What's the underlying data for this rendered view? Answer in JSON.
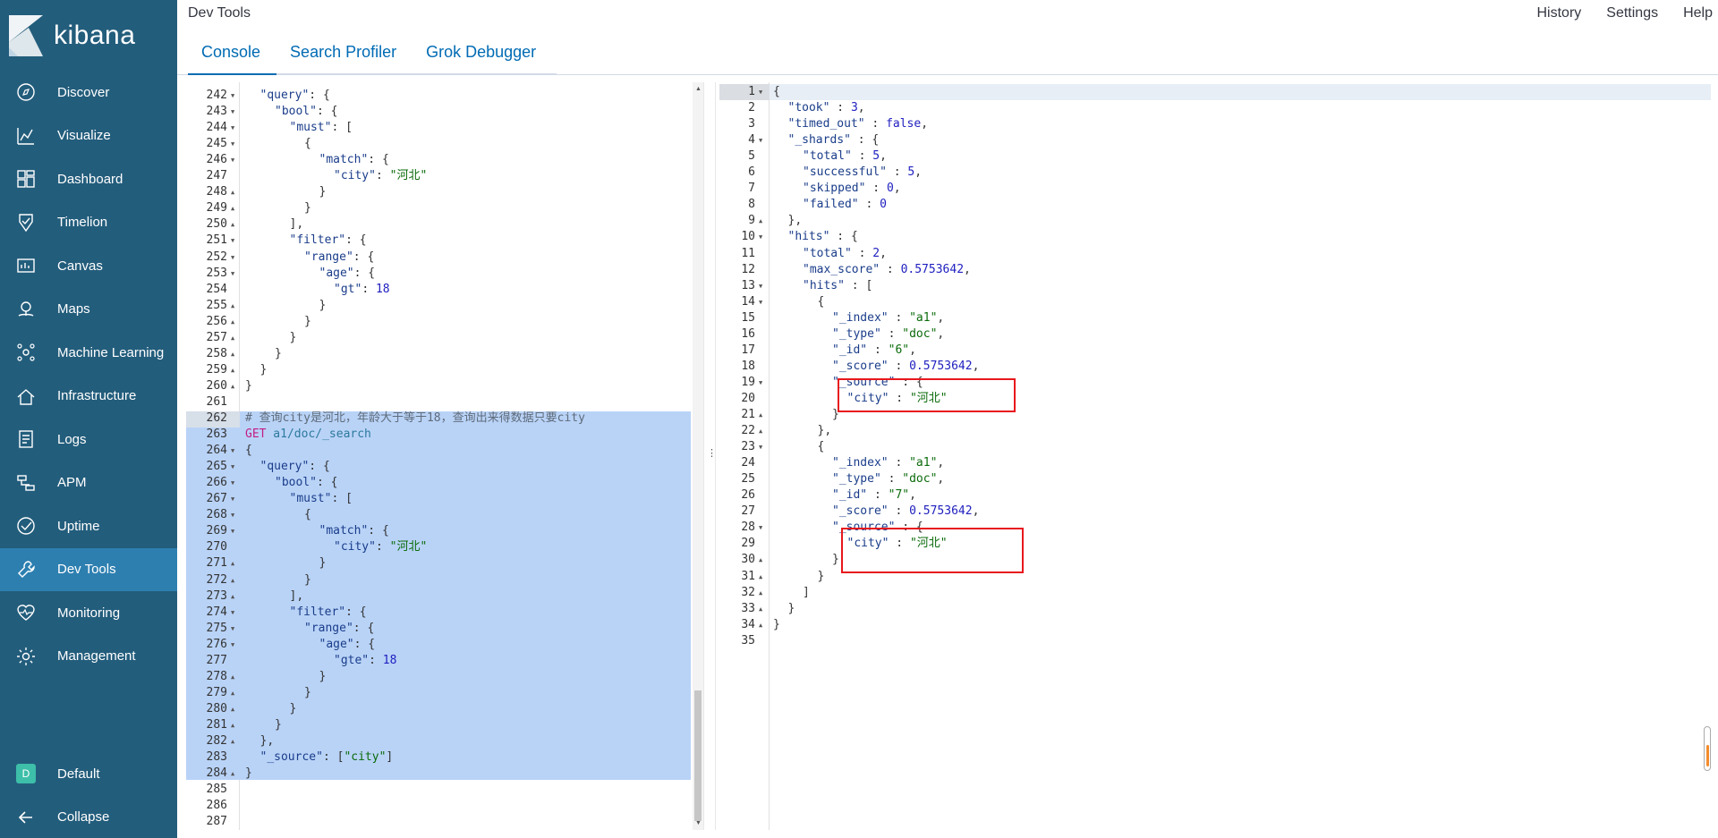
{
  "brand": {
    "name": "kibana"
  },
  "header": {
    "app_title": "Dev Tools",
    "links": [
      "History",
      "Settings",
      "Help"
    ],
    "tabs": [
      {
        "label": "Console",
        "active": true
      },
      {
        "label": "Search Profiler",
        "active": false
      },
      {
        "label": "Grok Debugger",
        "active": false
      }
    ]
  },
  "sidebar": {
    "items": [
      {
        "label": "Discover",
        "icon": "compass-icon"
      },
      {
        "label": "Visualize",
        "icon": "chart-icon"
      },
      {
        "label": "Dashboard",
        "icon": "dashboard-icon"
      },
      {
        "label": "Timelion",
        "icon": "timelion-icon"
      },
      {
        "label": "Canvas",
        "icon": "canvas-icon"
      },
      {
        "label": "Maps",
        "icon": "map-pin-icon"
      },
      {
        "label": "Machine Learning",
        "icon": "machine-learning-icon"
      },
      {
        "label": "Infrastructure",
        "icon": "infrastructure-icon"
      },
      {
        "label": "Logs",
        "icon": "logs-icon"
      },
      {
        "label": "APM",
        "icon": "apm-icon"
      },
      {
        "label": "Uptime",
        "icon": "uptime-icon"
      },
      {
        "label": "Dev Tools",
        "icon": "wrench-icon",
        "active": true
      },
      {
        "label": "Monitoring",
        "icon": "heartbeat-icon"
      },
      {
        "label": "Management",
        "icon": "gear-icon"
      }
    ],
    "space": {
      "badge": "D",
      "label": "Default"
    },
    "collapse_label": "Collapse"
  },
  "editor": {
    "lines": [
      {
        "n": "242",
        "f": "▼",
        "i": 1,
        "t": [
          [
            "key",
            "\"query\""
          ],
          [
            "k",
            ": {"
          ]
        ]
      },
      {
        "n": "243",
        "f": "▼",
        "i": 2,
        "t": [
          [
            "key",
            "\"bool\""
          ],
          [
            "k",
            ": {"
          ]
        ]
      },
      {
        "n": "244",
        "f": "▼",
        "i": 3,
        "t": [
          [
            "key",
            "\"must\""
          ],
          [
            "k",
            ": ["
          ]
        ]
      },
      {
        "n": "245",
        "f": "▼",
        "i": 4,
        "t": [
          [
            "k",
            "{"
          ]
        ]
      },
      {
        "n": "246",
        "f": "▼",
        "i": 5,
        "t": [
          [
            "key",
            "\"match\""
          ],
          [
            "k",
            ": {"
          ]
        ]
      },
      {
        "n": "247",
        "f": "",
        "i": 6,
        "t": [
          [
            "key",
            "\"city\""
          ],
          [
            "k",
            ": "
          ],
          [
            "str",
            "\"河北\""
          ]
        ]
      },
      {
        "n": "248",
        "f": "▲",
        "i": 5,
        "t": [
          [
            "k",
            "}"
          ]
        ]
      },
      {
        "n": "249",
        "f": "▲",
        "i": 4,
        "t": [
          [
            "k",
            "}"
          ]
        ]
      },
      {
        "n": "250",
        "f": "▲",
        "i": 3,
        "t": [
          [
            "k",
            "],"
          ]
        ]
      },
      {
        "n": "251",
        "f": "▼",
        "i": 3,
        "t": [
          [
            "key",
            "\"filter\""
          ],
          [
            "k",
            ": {"
          ]
        ]
      },
      {
        "n": "252",
        "f": "▼",
        "i": 4,
        "t": [
          [
            "key",
            "\"range\""
          ],
          [
            "k",
            ": {"
          ]
        ]
      },
      {
        "n": "253",
        "f": "▼",
        "i": 5,
        "t": [
          [
            "key",
            "\"age\""
          ],
          [
            "k",
            ": {"
          ]
        ]
      },
      {
        "n": "254",
        "f": "",
        "i": 6,
        "t": [
          [
            "key",
            "\"gt\""
          ],
          [
            "k",
            ": "
          ],
          [
            "num",
            "18"
          ]
        ]
      },
      {
        "n": "255",
        "f": "▲",
        "i": 5,
        "t": [
          [
            "k",
            "}"
          ]
        ]
      },
      {
        "n": "256",
        "f": "▲",
        "i": 4,
        "t": [
          [
            "k",
            "}"
          ]
        ]
      },
      {
        "n": "257",
        "f": "▲",
        "i": 3,
        "t": [
          [
            "k",
            "}"
          ]
        ]
      },
      {
        "n": "258",
        "f": "▲",
        "i": 2,
        "t": [
          [
            "k",
            "}"
          ]
        ]
      },
      {
        "n": "259",
        "f": "▲",
        "i": 1,
        "t": [
          [
            "k",
            "}"
          ]
        ]
      },
      {
        "n": "260",
        "f": "▲",
        "i": 0,
        "t": [
          [
            "k",
            "}"
          ]
        ]
      },
      {
        "n": "261",
        "f": "",
        "i": 0,
        "t": []
      },
      {
        "n": "262",
        "f": "",
        "i": 0,
        "t": [
          [
            "cmt",
            "# 查询city是河北，年龄大于等于18，查询出来得数据只要city"
          ]
        ]
      },
      {
        "n": "263",
        "f": "",
        "i": 0,
        "t": [
          [
            "kw",
            "GET"
          ],
          [
            "path",
            " a1/doc/_search"
          ]
        ]
      },
      {
        "n": "264",
        "f": "▼",
        "i": 0,
        "t": [
          [
            "k",
            "{"
          ]
        ]
      },
      {
        "n": "265",
        "f": "▼",
        "i": 1,
        "t": [
          [
            "key",
            "\"query\""
          ],
          [
            "k",
            ": {"
          ]
        ]
      },
      {
        "n": "266",
        "f": "▼",
        "i": 2,
        "t": [
          [
            "key",
            "\"bool\""
          ],
          [
            "k",
            ": {"
          ]
        ]
      },
      {
        "n": "267",
        "f": "▼",
        "i": 3,
        "t": [
          [
            "key",
            "\"must\""
          ],
          [
            "k",
            ": ["
          ]
        ]
      },
      {
        "n": "268",
        "f": "▼",
        "i": 4,
        "t": [
          [
            "k",
            "{"
          ]
        ]
      },
      {
        "n": "269",
        "f": "▼",
        "i": 5,
        "t": [
          [
            "key",
            "\"match\""
          ],
          [
            "k",
            ": {"
          ]
        ]
      },
      {
        "n": "270",
        "f": "",
        "i": 6,
        "t": [
          [
            "key",
            "\"city\""
          ],
          [
            "k",
            ": "
          ],
          [
            "str",
            "\"河北\""
          ]
        ]
      },
      {
        "n": "271",
        "f": "▲",
        "i": 5,
        "t": [
          [
            "k",
            "}"
          ]
        ]
      },
      {
        "n": "272",
        "f": "▲",
        "i": 4,
        "t": [
          [
            "k",
            "}"
          ]
        ]
      },
      {
        "n": "273",
        "f": "▲",
        "i": 3,
        "t": [
          [
            "k",
            "],"
          ]
        ]
      },
      {
        "n": "274",
        "f": "▼",
        "i": 3,
        "t": [
          [
            "key",
            "\"filter\""
          ],
          [
            "k",
            ": {"
          ]
        ]
      },
      {
        "n": "275",
        "f": "▼",
        "i": 4,
        "t": [
          [
            "key",
            "\"range\""
          ],
          [
            "k",
            ": {"
          ]
        ]
      },
      {
        "n": "276",
        "f": "▼",
        "i": 5,
        "t": [
          [
            "key",
            "\"age\""
          ],
          [
            "k",
            ": {"
          ]
        ]
      },
      {
        "n": "277",
        "f": "",
        "i": 6,
        "t": [
          [
            "key",
            "\"gte\""
          ],
          [
            "k",
            ": "
          ],
          [
            "num",
            "18"
          ]
        ]
      },
      {
        "n": "278",
        "f": "▲",
        "i": 5,
        "t": [
          [
            "k",
            "}"
          ]
        ]
      },
      {
        "n": "279",
        "f": "▲",
        "i": 4,
        "t": [
          [
            "k",
            "}"
          ]
        ]
      },
      {
        "n": "280",
        "f": "▲",
        "i": 3,
        "t": [
          [
            "k",
            "}"
          ]
        ]
      },
      {
        "n": "281",
        "f": "▲",
        "i": 2,
        "t": [
          [
            "k",
            "}"
          ]
        ]
      },
      {
        "n": "282",
        "f": "▲",
        "i": 1,
        "t": [
          [
            "k",
            "},"
          ]
        ]
      },
      {
        "n": "283",
        "f": "",
        "i": 1,
        "t": [
          [
            "key",
            "\"_source\""
          ],
          [
            "k",
            ": ["
          ],
          [
            "str",
            "\"city\""
          ],
          [
            "k",
            "]"
          ]
        ]
      },
      {
        "n": "284",
        "f": "▲",
        "i": 0,
        "t": [
          [
            "k",
            "}"
          ]
        ]
      },
      {
        "n": "285",
        "f": "",
        "i": 0,
        "t": []
      },
      {
        "n": "286",
        "f": "",
        "i": 0,
        "t": []
      },
      {
        "n": "287",
        "f": "",
        "i": 0,
        "t": []
      }
    ]
  },
  "output": {
    "lines": [
      {
        "n": "1",
        "f": "▼",
        "i": 0,
        "t": [
          [
            "k",
            "{"
          ]
        ]
      },
      {
        "n": "2",
        "f": "",
        "i": 1,
        "t": [
          [
            "key",
            "\"took\""
          ],
          [
            "k",
            " : "
          ],
          [
            "num",
            "3"
          ],
          [
            "k",
            ","
          ]
        ]
      },
      {
        "n": "3",
        "f": "",
        "i": 1,
        "t": [
          [
            "key",
            "\"timed_out\""
          ],
          [
            "k",
            " : "
          ],
          [
            "num",
            "false"
          ],
          [
            "k",
            ","
          ]
        ]
      },
      {
        "n": "4",
        "f": "▼",
        "i": 1,
        "t": [
          [
            "key",
            "\"_shards\""
          ],
          [
            "k",
            " : {"
          ]
        ]
      },
      {
        "n": "5",
        "f": "",
        "i": 2,
        "t": [
          [
            "key",
            "\"total\""
          ],
          [
            "k",
            " : "
          ],
          [
            "num",
            "5"
          ],
          [
            "k",
            ","
          ]
        ]
      },
      {
        "n": "6",
        "f": "",
        "i": 2,
        "t": [
          [
            "key",
            "\"successful\""
          ],
          [
            "k",
            " : "
          ],
          [
            "num",
            "5"
          ],
          [
            "k",
            ","
          ]
        ]
      },
      {
        "n": "7",
        "f": "",
        "i": 2,
        "t": [
          [
            "key",
            "\"skipped\""
          ],
          [
            "k",
            " : "
          ],
          [
            "num",
            "0"
          ],
          [
            "k",
            ","
          ]
        ]
      },
      {
        "n": "8",
        "f": "",
        "i": 2,
        "t": [
          [
            "key",
            "\"failed\""
          ],
          [
            "k",
            " : "
          ],
          [
            "num",
            "0"
          ]
        ]
      },
      {
        "n": "9",
        "f": "▲",
        "i": 1,
        "t": [
          [
            "k",
            "},"
          ]
        ]
      },
      {
        "n": "10",
        "f": "▼",
        "i": 1,
        "t": [
          [
            "key",
            "\"hits\""
          ],
          [
            "k",
            " : {"
          ]
        ]
      },
      {
        "n": "11",
        "f": "",
        "i": 2,
        "t": [
          [
            "key",
            "\"total\""
          ],
          [
            "k",
            " : "
          ],
          [
            "num",
            "2"
          ],
          [
            "k",
            ","
          ]
        ]
      },
      {
        "n": "12",
        "f": "",
        "i": 2,
        "t": [
          [
            "key",
            "\"max_score\""
          ],
          [
            "k",
            " : "
          ],
          [
            "num",
            "0.5753642"
          ],
          [
            "k",
            ","
          ]
        ]
      },
      {
        "n": "13",
        "f": "▼",
        "i": 2,
        "t": [
          [
            "key",
            "\"hits\""
          ],
          [
            "k",
            " : ["
          ]
        ]
      },
      {
        "n": "14",
        "f": "▼",
        "i": 3,
        "t": [
          [
            "k",
            "{"
          ]
        ]
      },
      {
        "n": "15",
        "f": "",
        "i": 4,
        "t": [
          [
            "key",
            "\"_index\""
          ],
          [
            "k",
            " : "
          ],
          [
            "str",
            "\"a1\""
          ],
          [
            "k",
            ","
          ]
        ]
      },
      {
        "n": "16",
        "f": "",
        "i": 4,
        "t": [
          [
            "key",
            "\"_type\""
          ],
          [
            "k",
            " : "
          ],
          [
            "str",
            "\"doc\""
          ],
          [
            "k",
            ","
          ]
        ]
      },
      {
        "n": "17",
        "f": "",
        "i": 4,
        "t": [
          [
            "key",
            "\"_id\""
          ],
          [
            "k",
            " : "
          ],
          [
            "str",
            "\"6\""
          ],
          [
            "k",
            ","
          ]
        ]
      },
      {
        "n": "18",
        "f": "",
        "i": 4,
        "t": [
          [
            "key",
            "\"_score\""
          ],
          [
            "k",
            " : "
          ],
          [
            "num",
            "0.5753642"
          ],
          [
            "k",
            ","
          ]
        ]
      },
      {
        "n": "19",
        "f": "▼",
        "i": 4,
        "t": [
          [
            "key",
            "\"_source\""
          ],
          [
            "k",
            " : {"
          ]
        ]
      },
      {
        "n": "20",
        "f": "",
        "i": 5,
        "t": [
          [
            "key",
            "\"city\""
          ],
          [
            "k",
            " : "
          ],
          [
            "str",
            "\"河北\""
          ]
        ]
      },
      {
        "n": "21",
        "f": "▲",
        "i": 4,
        "t": [
          [
            "k",
            "}"
          ]
        ]
      },
      {
        "n": "22",
        "f": "▲",
        "i": 3,
        "t": [
          [
            "k",
            "},"
          ]
        ]
      },
      {
        "n": "23",
        "f": "▼",
        "i": 3,
        "t": [
          [
            "k",
            "{"
          ]
        ]
      },
      {
        "n": "24",
        "f": "",
        "i": 4,
        "t": [
          [
            "key",
            "\"_index\""
          ],
          [
            "k",
            " : "
          ],
          [
            "str",
            "\"a1\""
          ],
          [
            "k",
            ","
          ]
        ]
      },
      {
        "n": "25",
        "f": "",
        "i": 4,
        "t": [
          [
            "key",
            "\"_type\""
          ],
          [
            "k",
            " : "
          ],
          [
            "str",
            "\"doc\""
          ],
          [
            "k",
            ","
          ]
        ]
      },
      {
        "n": "26",
        "f": "",
        "i": 4,
        "t": [
          [
            "key",
            "\"_id\""
          ],
          [
            "k",
            " : "
          ],
          [
            "str",
            "\"7\""
          ],
          [
            "k",
            ","
          ]
        ]
      },
      {
        "n": "27",
        "f": "",
        "i": 4,
        "t": [
          [
            "key",
            "\"_score\""
          ],
          [
            "k",
            " : "
          ],
          [
            "num",
            "0.5753642"
          ],
          [
            "k",
            ","
          ]
        ]
      },
      {
        "n": "28",
        "f": "▼",
        "i": 4,
        "t": [
          [
            "key",
            "\"_source\""
          ],
          [
            "k",
            " : {"
          ]
        ]
      },
      {
        "n": "29",
        "f": "",
        "i": 5,
        "t": [
          [
            "key",
            "\"city\""
          ],
          [
            "k",
            " : "
          ],
          [
            "str",
            "\"河北\""
          ]
        ]
      },
      {
        "n": "30",
        "f": "▲",
        "i": 4,
        "t": [
          [
            "k",
            "}"
          ]
        ]
      },
      {
        "n": "31",
        "f": "▲",
        "i": 3,
        "t": [
          [
            "k",
            "}"
          ]
        ]
      },
      {
        "n": "32",
        "f": "▲",
        "i": 2,
        "t": [
          [
            "k",
            "]"
          ]
        ]
      },
      {
        "n": "33",
        "f": "▲",
        "i": 1,
        "t": [
          [
            "k",
            "}"
          ]
        ]
      },
      {
        "n": "34",
        "f": "▲",
        "i": 0,
        "t": [
          [
            "k",
            "}"
          ]
        ]
      },
      {
        "n": "35",
        "f": "",
        "i": 0,
        "t": []
      }
    ]
  },
  "colors": {
    "sidebar_bg": "#235d7c",
    "sidebar_active": "#2d7fb0",
    "tab_accent": "#006bb4",
    "selection": "#b9d3f7",
    "highlight_box": "#e8171c"
  }
}
